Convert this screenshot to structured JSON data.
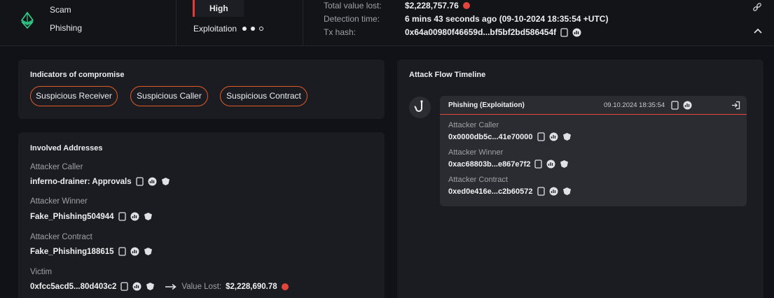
{
  "header": {
    "tags": [
      "Scam",
      "Phishing"
    ],
    "severity": "High",
    "stage": "Exploitation",
    "meta": [
      {
        "label": "Total value lost:",
        "value": "$2,228,757.76"
      },
      {
        "label": "Detection time:",
        "value": "6 mins 43 seconds ago (09-10-2024 18:35:54 +UTC)"
      },
      {
        "label": "Tx hash:",
        "value": "0x64a00980f46659d...bf5bf2bd586454f"
      }
    ]
  },
  "ioc": {
    "title": "Indicators of compromise",
    "pills": [
      "Suspicious Receiver",
      "Suspicious Caller",
      "Suspicious Contract"
    ]
  },
  "involved": {
    "title": "Involved Addresses",
    "items": [
      {
        "label": "Attacker Caller",
        "value": "inferno-drainer: Approvals"
      },
      {
        "label": "Attacker Winner",
        "value": "Fake_Phishing504944"
      },
      {
        "label": "Attacker Contract",
        "value": "Fake_Phishing188615"
      },
      {
        "label": "Victim",
        "value": "0xfcc5acd5...80d403c2",
        "value_lost_label": "Value Lost:",
        "value_lost": "$2,228,690.78"
      }
    ]
  },
  "timeline": {
    "title": "Attack Flow Timeline",
    "card": {
      "title": "Phishing  (Exploitation)",
      "time": "09.10.2024 18:35:54",
      "items": [
        {
          "label": "Attacker Caller",
          "value": "0x0000db5c...41e70000"
        },
        {
          "label": "Attacker Winner",
          "value": "0xac68803b...e867e7f2"
        },
        {
          "label": "Attacker Contract",
          "value": "0xed0e416e...c2b60572"
        }
      ]
    }
  },
  "colors": {
    "accent": "#e05a27",
    "danger": "#e2453b",
    "eth_green": "#2fd18a"
  }
}
